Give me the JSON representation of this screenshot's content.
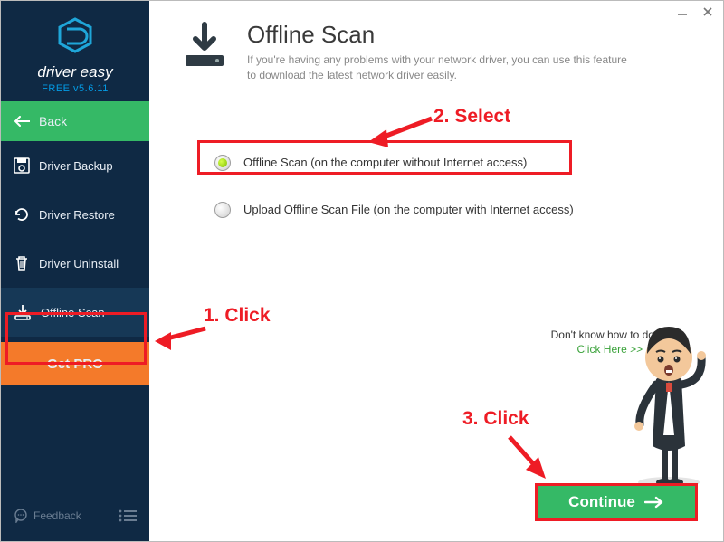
{
  "branding": {
    "name": "driver easy",
    "version": "FREE v5.6.11"
  },
  "sidebar": {
    "back": "Back",
    "items": [
      {
        "label": "Driver Backup"
      },
      {
        "label": "Driver Restore"
      },
      {
        "label": "Driver Uninstall"
      },
      {
        "label": "Offline Scan"
      }
    ],
    "getpro": "Get PRO",
    "feedback": "Feedback"
  },
  "header": {
    "title": "Offline Scan",
    "subtitle": "If you're having any problems with your network driver, you can use this feature to download the latest network driver easily."
  },
  "options": {
    "offline": "Offline Scan (on the computer without Internet access)",
    "upload": "Upload Offline Scan File (on the computer with Internet access)"
  },
  "helper": {
    "question": "Don't know how to do it?",
    "link": "Click Here >>"
  },
  "actions": {
    "continue": "Continue"
  },
  "annotations": {
    "step1": "1. Click",
    "step2": "2. Select",
    "step3": "3. Click"
  }
}
